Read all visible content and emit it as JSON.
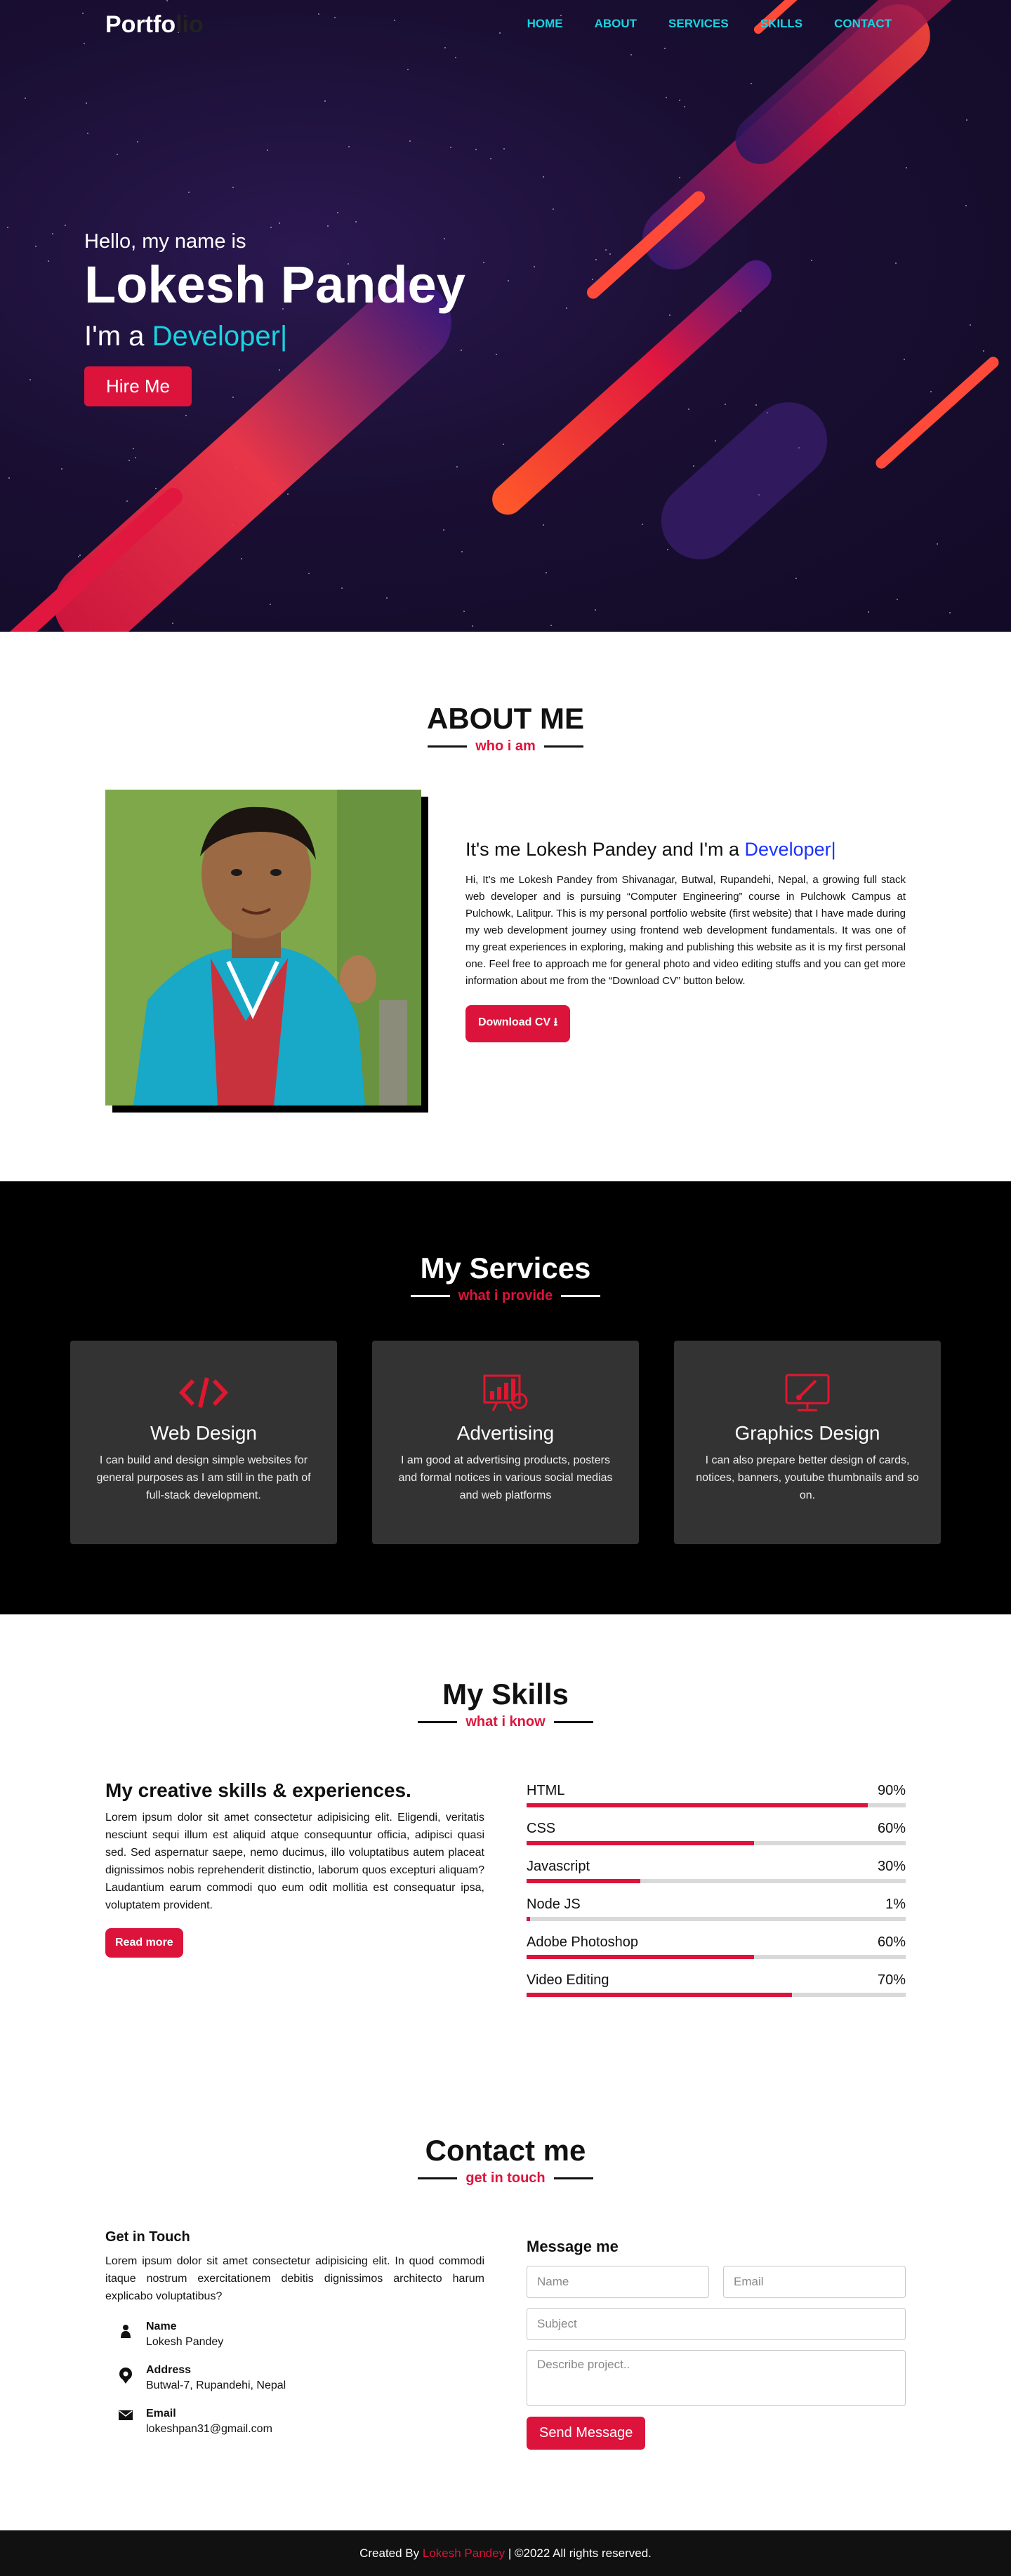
{
  "nav": {
    "logo_main": "Portfo",
    "logo_accent": "lio",
    "links": [
      "HOME",
      "ABOUT",
      "SERVICES",
      "SKILLS",
      "CONTACT"
    ]
  },
  "hero": {
    "greeting": "Hello, my name is",
    "name": "Lokesh Pandey",
    "role_prefix": "I'm a",
    "role_typed": "Developer|",
    "hire_button": "Hire Me"
  },
  "about": {
    "title": "ABOUT ME",
    "subtitle": "who i am",
    "heading_prefix": "It's me Lokesh Pandey and I'm a",
    "heading_typed": "Developer|",
    "paragraph": "Hi, It’s me Lokesh Pandey from Shivanagar, Butwal, Rupandehi, Nepal, a growing full stack web developer and is pursuing “Computer Engineering” course in Pulchowk Campus at Pulchowk, Lalitpur. This is my personal portfolio website (first website) that I have made during my web development journey using frontend web development fundamentals. It was one of my great experiences in exploring, making and publishing this website as it is my first personal one. Feel free to approach me for general photo and video editing stuffs and you can get more information about me from the “Download CV” button below.",
    "download_button": "Download CV"
  },
  "services": {
    "title": "My Services",
    "subtitle": "what i provide",
    "cards": [
      {
        "icon": "code-icon",
        "title": "Web Design",
        "desc": "I can build and design simple websites for general purposes as I am still in the path of full-stack development."
      },
      {
        "icon": "chart-icon",
        "title": "Advertising",
        "desc": "I am good at advertising products, posters and formal notices in various social medias and web platforms"
      },
      {
        "icon": "design-monitor-icon",
        "title": "Graphics Design",
        "desc": "I can also prepare better design of cards, notices, banners, youtube thumbnails and so on."
      }
    ]
  },
  "skills": {
    "title": "My Skills",
    "subtitle": "what i know",
    "heading": "My creative skills & experiences.",
    "paragraph": "Lorem ipsum dolor sit amet consectetur adipisicing elit. Eligendi, veritatis nesciunt sequi illum est aliquid atque consequuntur officia, adipisci quasi sed. Sed aspernatur saepe, nemo ducimus, illo voluptatibus autem placeat dignissimos nobis reprehenderit distinctio, laborum quos excepturi aliquam? Laudantium earum commodi quo eum odit mollitia est consequatur ipsa, voluptatem provident.",
    "read_more": "Read more",
    "items": [
      {
        "name": "HTML",
        "label": "90%",
        "level": 0.9
      },
      {
        "name": "CSS",
        "label": "60%",
        "level": 0.6
      },
      {
        "name": "Javascript",
        "label": "30%",
        "level": 0.3
      },
      {
        "name": "Node JS",
        "label": "1%",
        "level": 0.01
      },
      {
        "name": "Adobe Photoshop",
        "label": "60%",
        "level": 0.6
      },
      {
        "name": "Video Editing",
        "label": "70%",
        "level": 0.7
      }
    ]
  },
  "contact": {
    "title": "Contact me",
    "subtitle": "get in touch",
    "left_heading": "Get in Touch",
    "left_paragraph": "Lorem ipsum dolor sit amet consectetur adipisicing elit. In quod commodi itaque nostrum exercitationem debitis dignissimos architecto harum explicabo voluptatibus?",
    "info": [
      {
        "icon": "user-icon",
        "label": "Name",
        "value": "Lokesh Pandey"
      },
      {
        "icon": "location-icon",
        "label": "Address",
        "value": "Butwal-7, Rupandehi, Nepal"
      },
      {
        "icon": "envelope-icon",
        "label": "Email",
        "value": "lokeshpan31@gmail.com"
      }
    ],
    "form_heading": "Message me",
    "name_placeholder": "Name",
    "email_placeholder": "Email",
    "subject_placeholder": "Subject",
    "message_placeholder": "Describe project..",
    "send_button": "Send Message"
  },
  "footer": {
    "prefix": "Created By",
    "author": "Lokesh Pandey",
    "suffix": "| ©2022 All rights reserved."
  },
  "colors": {
    "accent": "#dc143c",
    "cyan": "#17d4e0",
    "hero_bg": "#1a0f33",
    "link_blue": "#1a33ff"
  }
}
